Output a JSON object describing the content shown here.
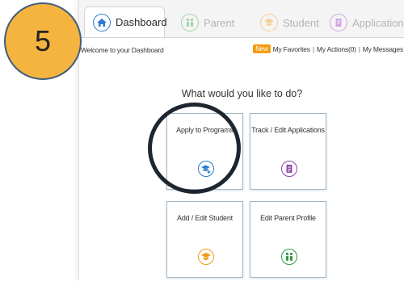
{
  "step_number": "5",
  "tabs": [
    {
      "label": "Dashboard",
      "icon": "house-icon",
      "active": true
    },
    {
      "label": "Parent",
      "icon": "parent-icon",
      "active": false
    },
    {
      "label": "Student",
      "icon": "graduation-cap-icon",
      "active": false
    },
    {
      "label": "Application",
      "icon": "document-icon",
      "active": false
    }
  ],
  "welcome_text": "Welcome to your Dashboard",
  "top_links": {
    "new_badge": "New",
    "favorites": "My Favorites",
    "actions": "My Actions(0)",
    "messages": "My Messages",
    "separator": "|"
  },
  "prompt": "What would you like to do?",
  "cards": [
    {
      "label": "Apply to Programs",
      "icon": "apply-programs-icon"
    },
    {
      "label": "Track / Edit Applications",
      "icon": "application-document-icon"
    },
    {
      "label": "Add / Edit Student",
      "icon": "student-icon"
    },
    {
      "label": "Edit Parent Profile",
      "icon": "parent-profile-icon"
    }
  ],
  "colors": {
    "dashboard_blue": "#2b7bd0",
    "parent_green": "#2e9b3f",
    "student_orange": "#f39c12",
    "application_purple": "#8e44ad",
    "badge_orange": "#f5b33f",
    "badge_border": "#3f5f7d"
  }
}
